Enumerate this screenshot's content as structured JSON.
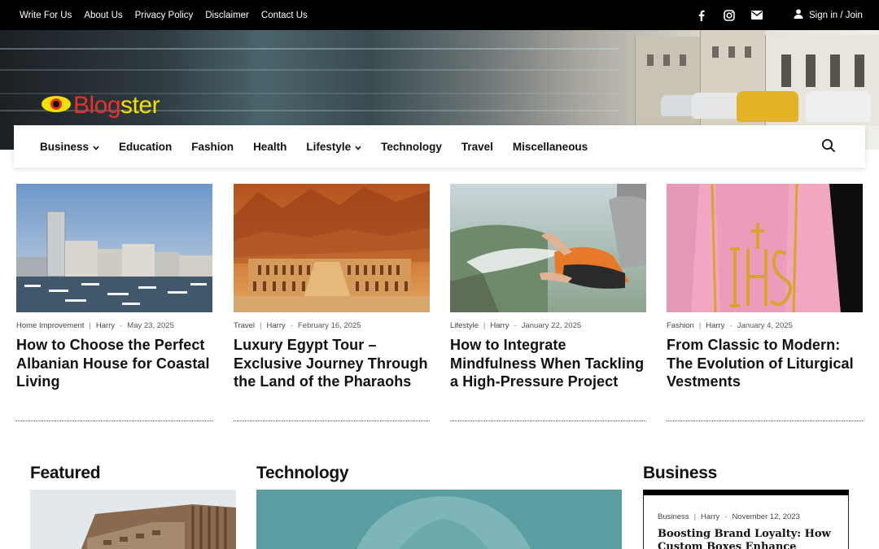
{
  "topbar": {
    "links": [
      "Write For Us",
      "About Us",
      "Privacy Policy",
      "Disclaimer",
      "Contact Us"
    ],
    "social_icons": [
      "facebook-icon",
      "instagram-icon",
      "mail-icon"
    ],
    "signin_label": "Sign in / Join"
  },
  "logo": {
    "part1": "Blog",
    "part2": "ster"
  },
  "nav": {
    "items": [
      {
        "label": "Business",
        "dropdown": true
      },
      {
        "label": "Education",
        "dropdown": false
      },
      {
        "label": "Fashion",
        "dropdown": false
      },
      {
        "label": "Health",
        "dropdown": false
      },
      {
        "label": "Lifestyle",
        "dropdown": true
      },
      {
        "label": "Technology",
        "dropdown": false
      },
      {
        "label": "Travel",
        "dropdown": false
      },
      {
        "label": "Miscellaneous",
        "dropdown": false
      }
    ],
    "search_icon": "search-icon"
  },
  "cards": [
    {
      "category": "Home Improvement",
      "author": "Harry",
      "date": "May 23, 2025",
      "title": "How to Choose the Perfect Albanian House for Coastal Living"
    },
    {
      "category": "Travel",
      "author": "Harry",
      "date": "February 16, 2025",
      "title": "Luxury Egypt Tour – Exclusive Journey Through the Land of the Pharaohs"
    },
    {
      "category": "Lifestyle",
      "author": "Harry",
      "date": "January 22, 2025",
      "title": "How to Integrate Mindfulness When Tackling a High-Pressure Project"
    },
    {
      "category": "Fashion",
      "author": "Harry",
      "date": "January 4, 2025",
      "title": "From Classic to Modern: The Evolution of Liturgical Vestments"
    }
  ],
  "sections": {
    "featured": "Featured",
    "technology": "Technology",
    "business": "Business"
  },
  "business_post": {
    "category": "Business",
    "author": "Harry",
    "date": "November 12, 2023",
    "title": "Boosting Brand Loyalty: How Custom Boxes Enhance Customer"
  },
  "colors": {
    "topbar_bg": "#000000",
    "logo_red": "#e8312b",
    "logo_yellow": "#f4e000"
  }
}
